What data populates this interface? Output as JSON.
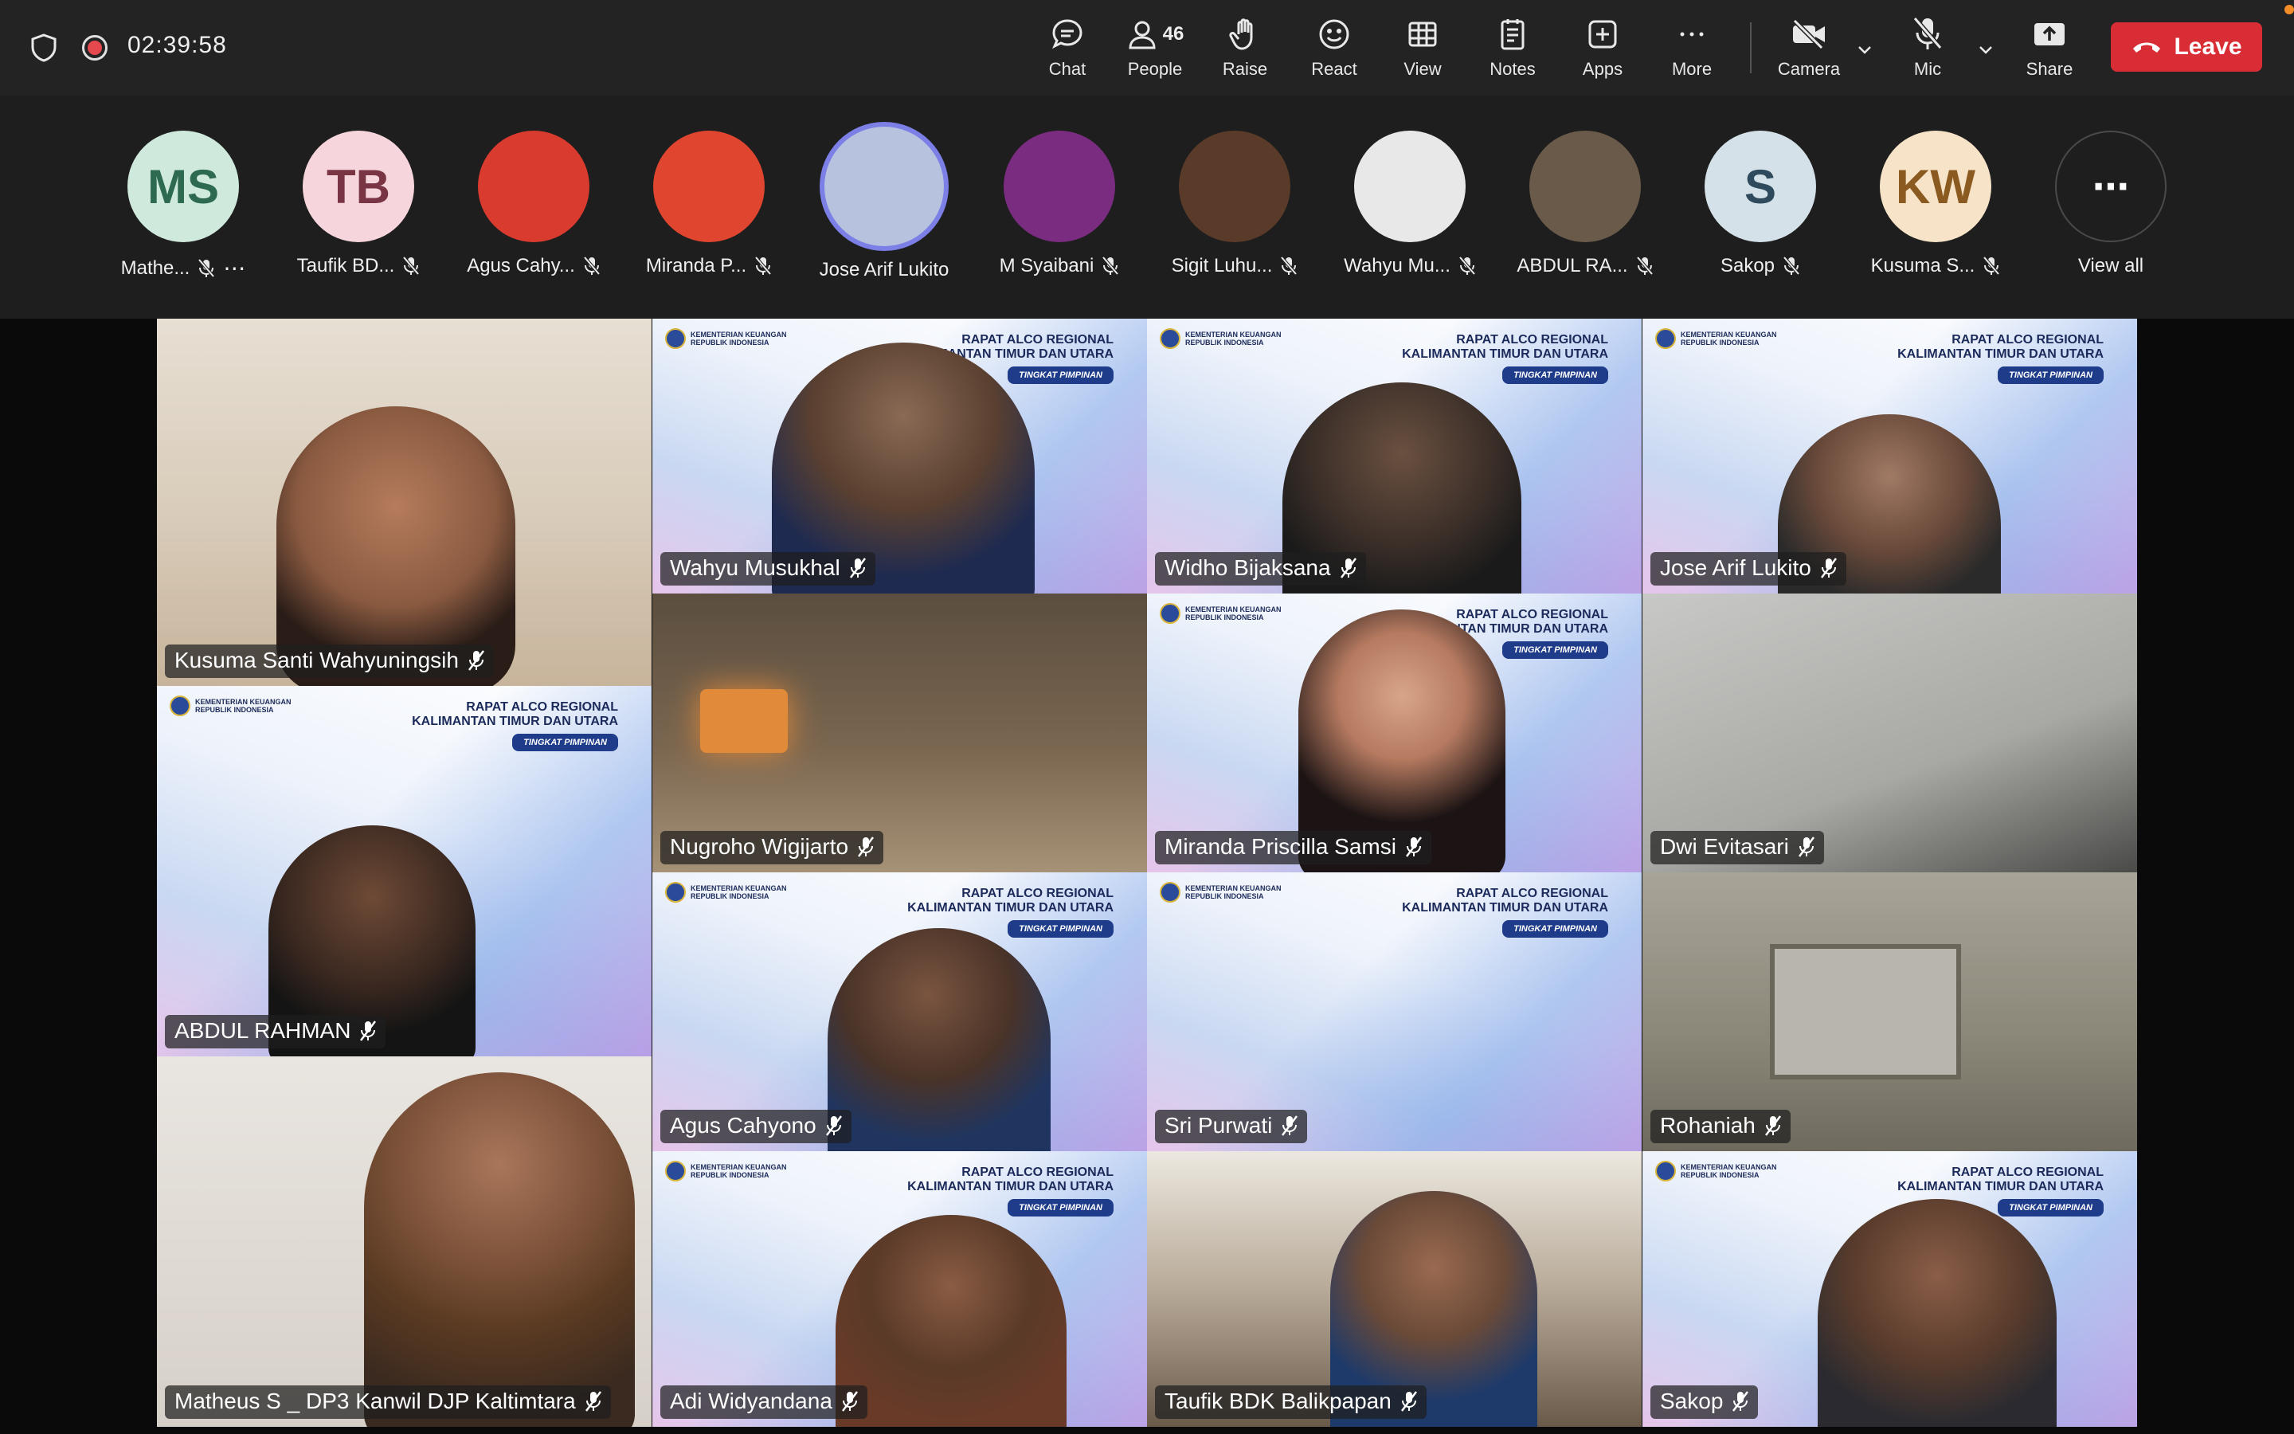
{
  "call": {
    "timer": "02:39:58"
  },
  "toolbar": {
    "chat": "Chat",
    "people": "People",
    "people_count": "46",
    "raise": "Raise",
    "react": "React",
    "view": "View",
    "notes": "Notes",
    "apps": "Apps",
    "more": "More",
    "camera": "Camera",
    "mic": "Mic",
    "share": "Share",
    "leave": "Leave"
  },
  "participants": [
    {
      "name": "Mathe...",
      "initials": "MS",
      "bg": "#cfe9dd",
      "fg": "#2d6a4f"
    },
    {
      "name": "Taufik BD...",
      "initials": "TB",
      "bg": "#f6d6dc",
      "fg": "#7a3545"
    },
    {
      "name": "Agus Cahy...",
      "initials": "",
      "bg": "#d93b2f",
      "fg": "#fff"
    },
    {
      "name": "Miranda P...",
      "initials": "",
      "bg": "#e0462f",
      "fg": "#fff"
    },
    {
      "name": "Jose Arif Lukito",
      "initials": "",
      "bg": "#b7c3de",
      "fg": "#fff"
    },
    {
      "name": "M Syaibani",
      "initials": "",
      "bg": "#7a2c80",
      "fg": "#fff"
    },
    {
      "name": "Sigit Luhu...",
      "initials": "",
      "bg": "#5a3b2a",
      "fg": "#fff"
    },
    {
      "name": "Wahyu Mu...",
      "initials": "",
      "bg": "#e8e8e8",
      "fg": "#fff"
    },
    {
      "name": "ABDUL RA...",
      "initials": "",
      "bg": "#6a5a4a",
      "fg": "#fff"
    },
    {
      "name": "Sakop",
      "initials": "S",
      "bg": "#d4e1e8",
      "fg": "#2e4a5c"
    },
    {
      "name": "Kusuma S...",
      "initials": "KW",
      "bg": "#f7e4c8",
      "fg": "#8a5a20"
    }
  ],
  "view_all": "View all",
  "slide": {
    "ministry": "KEMENTERIAN KEUANGAN",
    "country": "REPUBLIK INDONESIA",
    "title1": "RAPAT ALCO REGIONAL",
    "title2": "KALIMANTAN TIMUR DAN UTARA",
    "pill": "TINGKAT PIMPINAN"
  },
  "tiles": [
    {
      "name": "Kusuma Santi Wahyuningsih"
    },
    {
      "name": "Wahyu Musukhal"
    },
    {
      "name": "Widho Bijaksana"
    },
    {
      "name": "Jose Arif Lukito"
    },
    {
      "name": "ABDUL RAHMAN"
    },
    {
      "name": "Nugroho Wigijarto"
    },
    {
      "name": "Miranda Priscilla Samsi"
    },
    {
      "name": "Dwi Evitasari"
    },
    {
      "name": "Agus Cahyono"
    },
    {
      "name": "Sri Purwati"
    },
    {
      "name": "Rohaniah"
    },
    {
      "name": "Matheus S _ DP3 Kanwil DJP Kaltimtara"
    },
    {
      "name": "Adi Widyandana"
    },
    {
      "name": "Taufik BDK Balikpapan"
    },
    {
      "name": "Sakop"
    }
  ],
  "colors": {
    "leave": "#d92d35",
    "active_ring": "#7b7fe6",
    "toolbar_bg": "#232323"
  }
}
